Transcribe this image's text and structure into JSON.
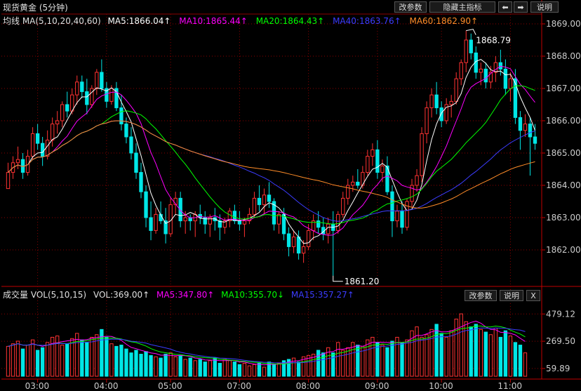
{
  "top": {
    "title": "现货黄金 (5分钟)",
    "buttons": {
      "params": "改参数",
      "hide": "隐藏主指标",
      "prev": "⬅",
      "next": "➡",
      "help": "说明"
    }
  },
  "main": {
    "ma_label": "均线 MA(5,10,20,40,60)",
    "ma5": "MA5:1866.04↑",
    "ma10": "MA10:1865.44↑",
    "ma20": "MA20:1864.43↑",
    "ma40": "MA40:1863.76↑",
    "ma60": "MA60:1862.90↑",
    "high_note": "1868.79",
    "low_note": "1861.20",
    "y_ticks": [
      "1869.00",
      "1868.00",
      "1867.00",
      "1866.00",
      "1865.00",
      "1864.00",
      "1863.00",
      "1862.00"
    ]
  },
  "volume": {
    "label": "成交量 VOL(5,10,15)",
    "vol": "VOL:369.00↑",
    "ma5": "MA5:347.80↑",
    "ma10": "MA10:355.70↓",
    "ma15": "MA15:357.27↑",
    "buttons": {
      "params": "改参数",
      "help": "说明",
      "close": "X"
    },
    "y_ticks": [
      "479.12",
      "269.50",
      "59.89"
    ]
  },
  "x_labels": [
    "03:00",
    "04:00",
    "05:00",
    "07:00",
    "08:00",
    "09:00",
    "10:00",
    "11:00"
  ],
  "colors": {
    "up": "#ff3232",
    "down": "#00e6e6",
    "ma5": "#ffffff",
    "ma10": "#ff00ff",
    "ma20": "#00ff00",
    "ma40": "#3c3cff",
    "ma60": "#ff8c28",
    "grid": "#8b0000"
  },
  "chart_data": [
    {
      "type": "candlestick",
      "title": "现货黄金 (5分钟)",
      "ylim": [
        1861.2,
        1869.4
      ],
      "x_labels": [
        "03:00",
        "04:00",
        "05:00",
        "07:00",
        "08:00",
        "09:00",
        "10:00",
        "11:00"
      ],
      "bars": [
        [
          1863.9,
          1864.7,
          1864.1,
          1864.4
        ],
        [
          1864.4,
          1864.9,
          1864.2,
          1864.7
        ],
        [
          1864.7,
          1865.2,
          1864.5,
          1864.8
        ],
        [
          1864.8,
          1865.0,
          1864.2,
          1864.4
        ],
        [
          1864.4,
          1865.1,
          1864.3,
          1864.9
        ],
        [
          1864.9,
          1865.8,
          1864.8,
          1865.6
        ],
        [
          1865.6,
          1865.9,
          1865.1,
          1865.3
        ],
        [
          1865.3,
          1865.5,
          1864.6,
          1864.9
        ],
        [
          1864.9,
          1865.7,
          1864.8,
          1865.4
        ],
        [
          1865.4,
          1866.1,
          1865.2,
          1865.9
        ],
        [
          1865.9,
          1866.3,
          1865.6,
          1866.0
        ],
        [
          1866.0,
          1866.6,
          1865.8,
          1866.5
        ],
        [
          1866.5,
          1866.9,
          1866.1,
          1866.3
        ],
        [
          1866.3,
          1867.0,
          1866.2,
          1866.8
        ],
        [
          1866.8,
          1867.4,
          1866.5,
          1867.2
        ],
        [
          1867.2,
          1867.4,
          1866.7,
          1866.9
        ],
        [
          1866.9,
          1867.3,
          1866.2,
          1866.5
        ],
        [
          1866.5,
          1867.1,
          1866.4,
          1867.0
        ],
        [
          1867.0,
          1867.6,
          1866.8,
          1867.5
        ],
        [
          1867.5,
          1867.9,
          1866.9,
          1867.0
        ],
        [
          1867.0,
          1867.2,
          1866.4,
          1866.6
        ],
        [
          1866.6,
          1867.1,
          1866.5,
          1867.0
        ],
        [
          1867.0,
          1867.2,
          1866.3,
          1866.4
        ],
        [
          1866.4,
          1866.8,
          1865.7,
          1865.9
        ],
        [
          1865.9,
          1866.1,
          1865.3,
          1865.5
        ],
        [
          1865.5,
          1865.8,
          1864.8,
          1865.0
        ],
        [
          1865.0,
          1865.3,
          1864.2,
          1864.4
        ],
        [
          1864.4,
          1864.7,
          1863.6,
          1863.8
        ],
        [
          1863.8,
          1864.0,
          1862.7,
          1863.0
        ],
        [
          1863.0,
          1863.5,
          1862.3,
          1862.6
        ],
        [
          1862.6,
          1863.3,
          1862.5,
          1863.1
        ],
        [
          1863.1,
          1863.5,
          1862.8,
          1862.9
        ],
        [
          1862.9,
          1863.3,
          1862.2,
          1862.5
        ],
        [
          1862.5,
          1863.6,
          1862.4,
          1863.4
        ],
        [
          1863.4,
          1863.8,
          1863.1,
          1863.6
        ],
        [
          1863.6,
          1863.8,
          1862.7,
          1862.9
        ],
        [
          1862.9,
          1863.2,
          1862.5,
          1863.0
        ],
        [
          1863.0,
          1863.1,
          1862.6,
          1862.9
        ],
        [
          1862.9,
          1863.2,
          1862.4,
          1863.1
        ],
        [
          1863.1,
          1863.4,
          1862.8,
          1863.0
        ],
        [
          1863.0,
          1863.2,
          1862.5,
          1862.8
        ],
        [
          1862.8,
          1863.1,
          1862.4,
          1863.0
        ],
        [
          1863.0,
          1863.3,
          1862.6,
          1862.9
        ],
        [
          1862.9,
          1863.1,
          1862.3,
          1862.7
        ],
        [
          1862.7,
          1863.0,
          1862.5,
          1862.9
        ],
        [
          1862.9,
          1863.3,
          1862.7,
          1863.2
        ],
        [
          1863.2,
          1863.4,
          1862.8,
          1862.9
        ],
        [
          1862.9,
          1863.2,
          1862.6,
          1862.8
        ],
        [
          1862.8,
          1863.0,
          1862.4,
          1862.9
        ],
        [
          1862.9,
          1863.3,
          1862.8,
          1863.1
        ],
        [
          1863.1,
          1863.8,
          1863.0,
          1863.6
        ],
        [
          1863.6,
          1864.0,
          1863.2,
          1863.4
        ],
        [
          1863.4,
          1863.9,
          1863.1,
          1863.7
        ],
        [
          1863.7,
          1864.1,
          1863.3,
          1863.5
        ],
        [
          1863.5,
          1863.6,
          1862.6,
          1862.8
        ],
        [
          1862.8,
          1863.2,
          1862.5,
          1863.1
        ],
        [
          1863.1,
          1863.3,
          1862.3,
          1862.5
        ],
        [
          1862.5,
          1862.7,
          1861.8,
          1862.1
        ],
        [
          1862.1,
          1862.6,
          1861.9,
          1862.4
        ],
        [
          1862.4,
          1862.6,
          1861.7,
          1861.9
        ],
        [
          1861.9,
          1862.3,
          1861.6,
          1862.1
        ],
        [
          1862.1,
          1862.8,
          1862.0,
          1862.6
        ],
        [
          1862.6,
          1863.1,
          1862.3,
          1862.9
        ],
        [
          1862.9,
          1863.2,
          1862.5,
          1862.7
        ],
        [
          1862.7,
          1863.0,
          1862.3,
          1862.5
        ],
        [
          1862.5,
          1863.0,
          1862.2,
          1862.8
        ],
        [
          1862.8,
          1863.2,
          1861.2,
          1862.6
        ],
        [
          1862.6,
          1863.2,
          1862.5,
          1863.1
        ],
        [
          1863.1,
          1863.8,
          1863.0,
          1863.6
        ],
        [
          1863.6,
          1864.2,
          1863.4,
          1864.0
        ],
        [
          1864.0,
          1864.3,
          1863.8,
          1864.1
        ],
        [
          1864.1,
          1864.5,
          1863.9,
          1864.0
        ],
        [
          1864.0,
          1864.6,
          1863.9,
          1864.4
        ],
        [
          1864.4,
          1865.1,
          1864.3,
          1864.9
        ],
        [
          1864.9,
          1865.3,
          1864.6,
          1865.1
        ],
        [
          1865.1,
          1865.4,
          1864.2,
          1864.4
        ],
        [
          1864.4,
          1864.8,
          1864.1,
          1864.6
        ],
        [
          1864.6,
          1864.9,
          1863.7,
          1863.8
        ],
        [
          1863.8,
          1864.0,
          1862.4,
          1862.9
        ],
        [
          1862.9,
          1863.4,
          1862.7,
          1863.2
        ],
        [
          1863.2,
          1863.5,
          1862.5,
          1862.7
        ],
        [
          1862.7,
          1863.6,
          1862.6,
          1863.5
        ],
        [
          1863.5,
          1864.2,
          1863.3,
          1864.0
        ],
        [
          1864.0,
          1864.5,
          1863.8,
          1864.3
        ],
        [
          1864.3,
          1865.8,
          1864.1,
          1865.6
        ],
        [
          1865.6,
          1866.6,
          1865.3,
          1866.4
        ],
        [
          1866.4,
          1867.0,
          1866.1,
          1866.8
        ],
        [
          1866.8,
          1867.2,
          1866.2,
          1866.4
        ],
        [
          1866.4,
          1866.6,
          1865.8,
          1866.0
        ],
        [
          1866.0,
          1866.7,
          1865.9,
          1866.5
        ],
        [
          1866.5,
          1866.8,
          1866.1,
          1866.6
        ],
        [
          1866.6,
          1867.5,
          1866.5,
          1867.3
        ],
        [
          1867.3,
          1867.9,
          1867.1,
          1867.8
        ],
        [
          1867.8,
          1868.79,
          1867.5,
          1868.5
        ],
        [
          1868.5,
          1868.7,
          1867.9,
          1868.1
        ],
        [
          1868.1,
          1868.3,
          1867.3,
          1867.5
        ],
        [
          1867.5,
          1867.8,
          1867.1,
          1867.6
        ],
        [
          1867.6,
          1867.8,
          1867.0,
          1867.2
        ],
        [
          1867.2,
          1867.7,
          1867.0,
          1867.5
        ],
        [
          1867.5,
          1868.0,
          1867.2,
          1867.8
        ],
        [
          1867.8,
          1868.2,
          1867.4,
          1867.6
        ],
        [
          1867.6,
          1867.9,
          1866.8,
          1867.0
        ],
        [
          1867.0,
          1867.5,
          1866.6,
          1867.3
        ],
        [
          1867.3,
          1867.6,
          1865.9,
          1866.1
        ],
        [
          1866.1,
          1866.3,
          1865.1,
          1865.7
        ],
        [
          1865.7,
          1866.2,
          1865.5,
          1865.9
        ],
        [
          1865.9,
          1866.1,
          1864.3,
          1865.5
        ],
        [
          1865.5,
          1865.9,
          1865.1,
          1865.3
        ]
      ],
      "series": [
        {
          "name": "MA5",
          "last": 1866.04
        },
        {
          "name": "MA10",
          "last": 1865.44
        },
        {
          "name": "MA20",
          "last": 1864.43
        },
        {
          "name": "MA40",
          "last": 1863.76
        },
        {
          "name": "MA60",
          "last": 1862.9
        }
      ],
      "annotations": [
        {
          "label": "1868.79"
        },
        {
          "label": "1861.20"
        }
      ]
    },
    {
      "type": "bar",
      "title": "成交量 VOL(5,10,15)",
      "ylim": [
        0,
        540
      ],
      "values": [
        230,
        250,
        270,
        210,
        240,
        280,
        200,
        220,
        260,
        300,
        310,
        240,
        250,
        290,
        330,
        280,
        260,
        300,
        320,
        360,
        300,
        250,
        230,
        240,
        210,
        180,
        200,
        170,
        190,
        160,
        150,
        140,
        170,
        180,
        150,
        160,
        130,
        140,
        120,
        130,
        110,
        120,
        140,
        100,
        130,
        120,
        110,
        90,
        100,
        80,
        90,
        100,
        70,
        110,
        90,
        100,
        120,
        130,
        140,
        110,
        150,
        160,
        170,
        200,
        180,
        220,
        180,
        260,
        200,
        220,
        260,
        240,
        230,
        280,
        300,
        260,
        240,
        220,
        270,
        300,
        260,
        280,
        350,
        380,
        300,
        320,
        360,
        400,
        330,
        300,
        350,
        440,
        480,
        420,
        380,
        400,
        360,
        340,
        320,
        370,
        300,
        350,
        310,
        260,
        240,
        180
      ],
      "series": [
        {
          "name": "MA5",
          "last": 347.8
        },
        {
          "name": "MA10",
          "last": 355.7
        },
        {
          "name": "MA15",
          "last": 357.27
        }
      ]
    }
  ]
}
